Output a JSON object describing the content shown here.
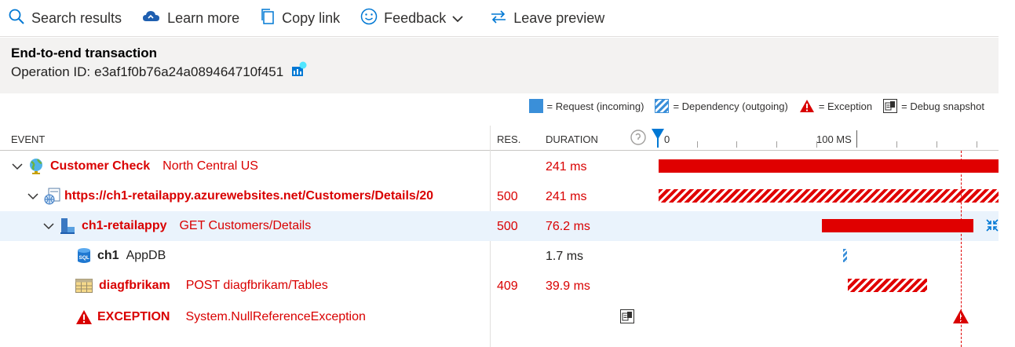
{
  "toolbar": {
    "search": "Search results",
    "learn": "Learn more",
    "copy": "Copy link",
    "feedback": "Feedback",
    "leave": "Leave preview"
  },
  "header": {
    "title": "End-to-end transaction",
    "operation_label": "Operation ID:",
    "operation_id": "e3af1f0b76a24a089464710f451"
  },
  "legend": {
    "request": "= Request (incoming)",
    "dependency": "= Dependency (outgoing)",
    "exception": "= Exception",
    "snapshot": "= Debug snapshot"
  },
  "columns": {
    "event": "EVENT",
    "res": "RES.",
    "duration": "DURATION",
    "tick0": "0",
    "tick100": "100 MS"
  },
  "rows": [
    {
      "name": "Customer Check",
      "sub": "North Central US",
      "res": "",
      "duration": "241 ms"
    },
    {
      "name": "https://ch1-retailappy.azurewebsites.net/Customers/Details/20",
      "sub": "",
      "res": "500",
      "duration": "241 ms"
    },
    {
      "name": "ch1-retailappy",
      "sub": "GET Customers/Details",
      "res": "500",
      "duration": "76.2 ms"
    },
    {
      "name": "ch1",
      "sub": "AppDB",
      "res": "",
      "duration": "1.7 ms"
    },
    {
      "name": "diagfbrikam",
      "sub": "POST diagfbrikam/Tables",
      "res": "409",
      "duration": "39.9 ms"
    },
    {
      "name": "EXCEPTION",
      "sub": "System.NullReferenceException",
      "res": "",
      "duration": ""
    }
  ],
  "colors": {
    "error": "#d90000",
    "request": "#3a8fd9",
    "selected_row": "#eaf3fc"
  }
}
